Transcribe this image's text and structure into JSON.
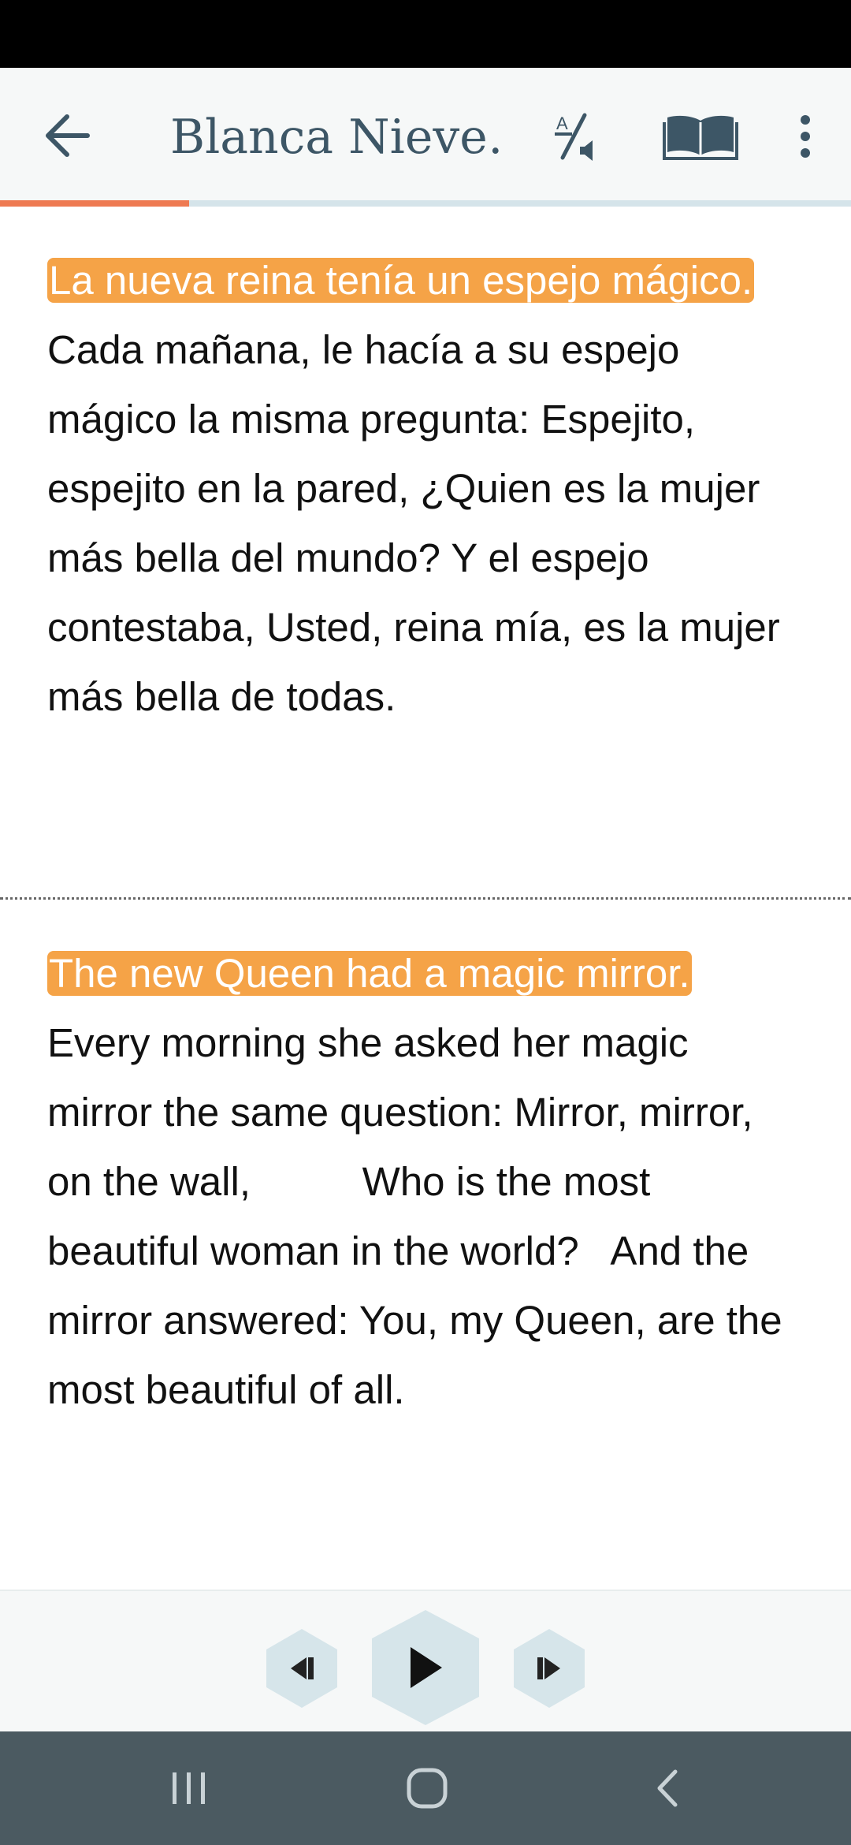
{
  "header": {
    "title": "Blanca Nieve…",
    "icons": [
      "arrow-left-icon",
      "translate-audio-icon",
      "open-book-icon",
      "more-vert-icon"
    ]
  },
  "progress": {
    "fraction": 0.222
  },
  "story": {
    "spanish": {
      "highlighted": "La nueva reina tenía un espejo mágico.",
      "rest": " Cada mañana, le hacía a su espejo mágico la misma pregunta: Espejito, espejito en la pared, ¿Quien es la mujer más bella del mundo? Y el espejo contestaba, Usted, reina mía, es la mujer más bella de todas."
    },
    "english": {
      "highlighted": "The new Queen had a magic mirror.",
      "rest": " Every morning she asked her magic mirror the same question: Mirror, mirror, on the wall,          Who is the most beautiful woman in the world?   And the mirror answered: You, my Queen, are the most beautiful of all."
    }
  },
  "player": {
    "icons": [
      "previous-icon",
      "play-icon",
      "next-icon"
    ]
  },
  "colors": {
    "highlight": "#f5a347",
    "progress": "#ee7a52",
    "title": "#3d5666",
    "control_bg": "#d6e5ea",
    "nav_bar": "#4b5a61"
  }
}
